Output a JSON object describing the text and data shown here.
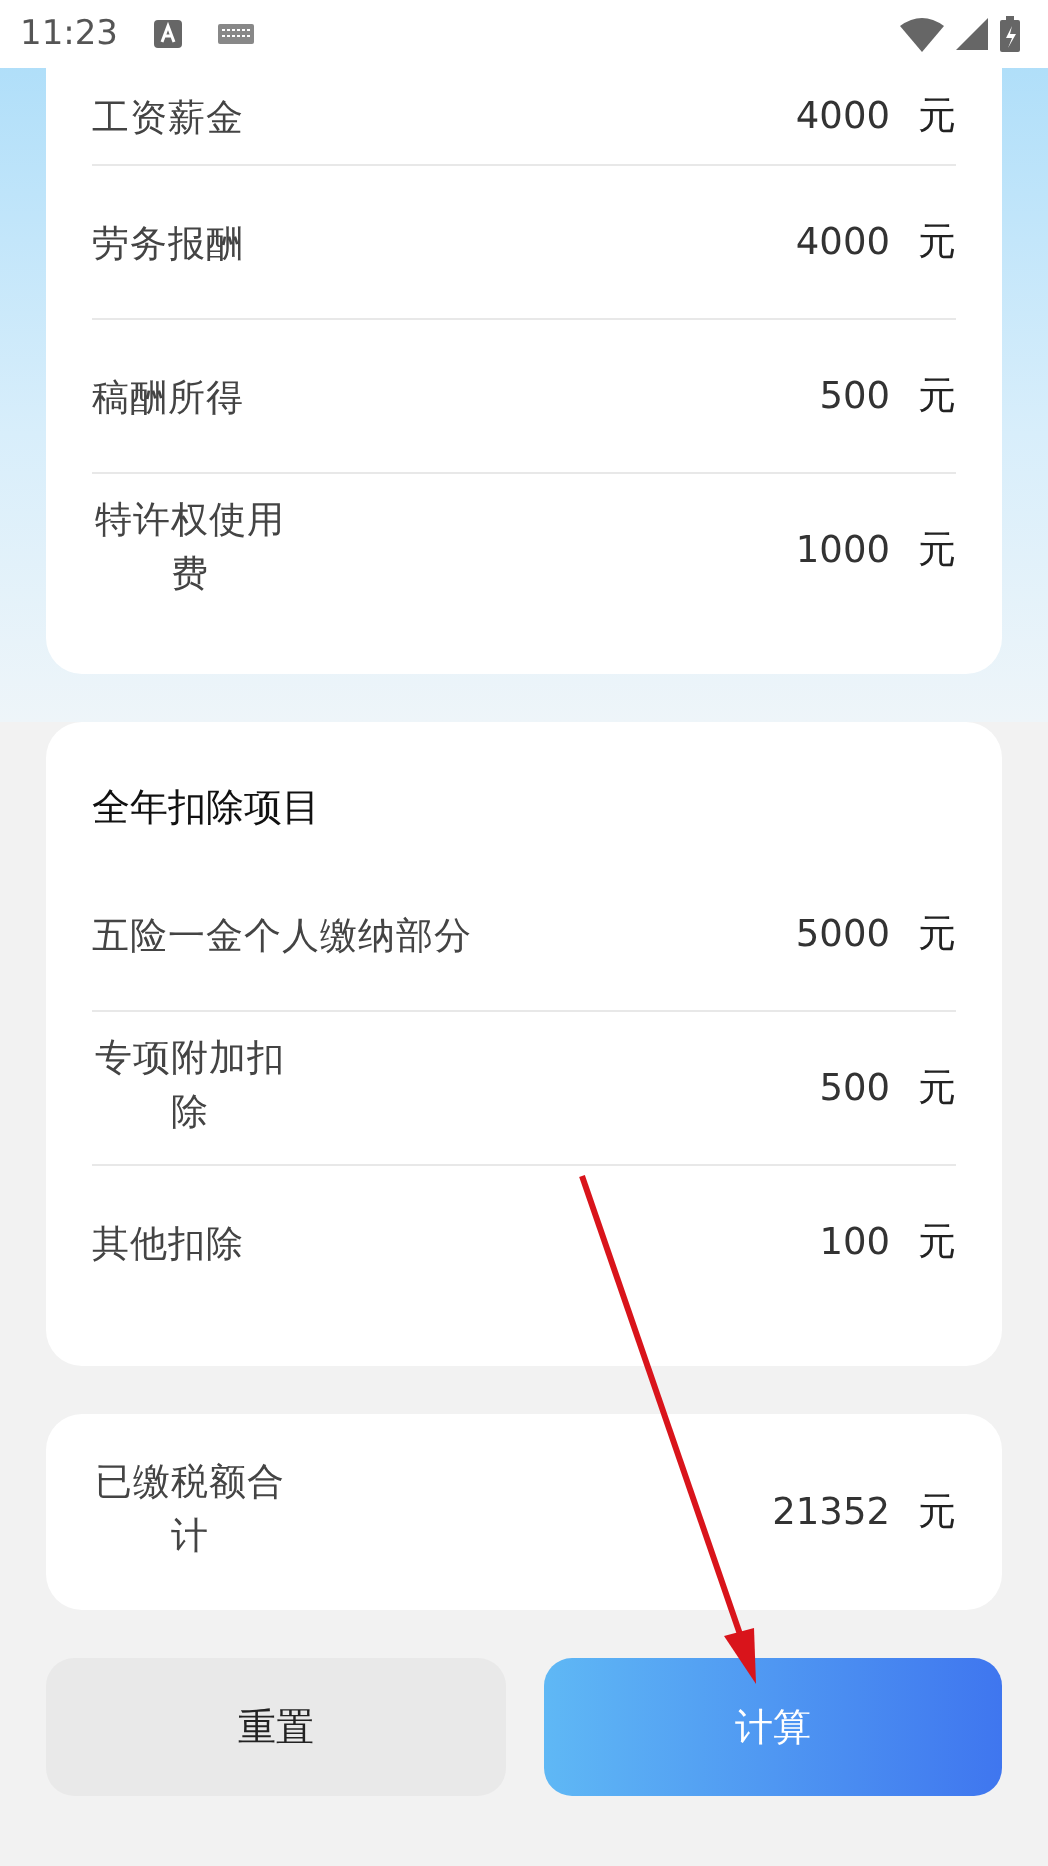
{
  "status_bar": {
    "time": "11:23"
  },
  "income": {
    "rows": [
      {
        "label": "工资薪金",
        "kind": "plain",
        "value": "4000",
        "unit": "元"
      },
      {
        "label": "劳务报酬",
        "kind": "plain",
        "value": "4000",
        "unit": "元"
      },
      {
        "label": "稿酬所得",
        "kind": "plain",
        "value": "500",
        "unit": "元"
      },
      {
        "label": "特许权使用费",
        "kind": "wrapped",
        "value": "1000",
        "unit": "元"
      }
    ]
  },
  "deductions": {
    "title": "全年扣除项目",
    "rows": [
      {
        "label": "五险一金个人缴纳部分",
        "kind": "plain",
        "value": "5000",
        "unit": "元"
      },
      {
        "label": "专项附加扣除",
        "kind": "wrapped",
        "value": "500",
        "unit": "元"
      },
      {
        "label": "其他扣除",
        "kind": "plain",
        "value": "100",
        "unit": "元"
      }
    ]
  },
  "paid": {
    "label": "已缴税额合计",
    "kind": "wrapped",
    "value": "21352",
    "unit": "元"
  },
  "buttons": {
    "reset": "重置",
    "calculate": "计算"
  }
}
